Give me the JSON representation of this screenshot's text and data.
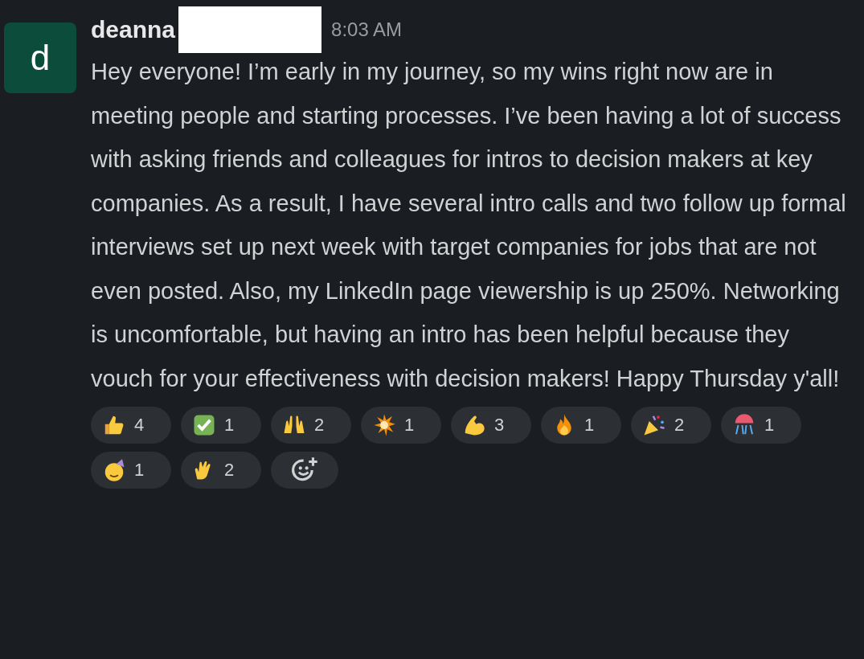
{
  "message": {
    "avatar_letter": "d",
    "author": "deanna",
    "time": "8:03 AM",
    "text": "Hey everyone! I’m early in my journey, so my wins right now are in meeting people and starting processes. I’ve been having a lot of success with asking friends and colleagues for intros to decision makers at key companies. As a result, I have several intro calls and two follow up formal interviews set up next week with target companies for jobs that are not even posted. Also, my LinkedIn page viewership is up 250%. Networking is uncomfortable, but having an intro has been helpful because they vouch for your effectiveness with decision makers! Happy Thursday y'all!"
  },
  "reactions": [
    {
      "kind": "thumbs",
      "count": "4"
    },
    {
      "kind": "check",
      "count": "1"
    },
    {
      "kind": "hands",
      "count": "2"
    },
    {
      "kind": "burst",
      "count": "1"
    },
    {
      "kind": "muscle",
      "count": "3"
    },
    {
      "kind": "fire",
      "count": "1"
    },
    {
      "kind": "popper",
      "count": "2"
    },
    {
      "kind": "confetti",
      "count": "1"
    },
    {
      "kind": "partyface",
      "count": "1"
    },
    {
      "kind": "clap",
      "count": "2"
    }
  ]
}
